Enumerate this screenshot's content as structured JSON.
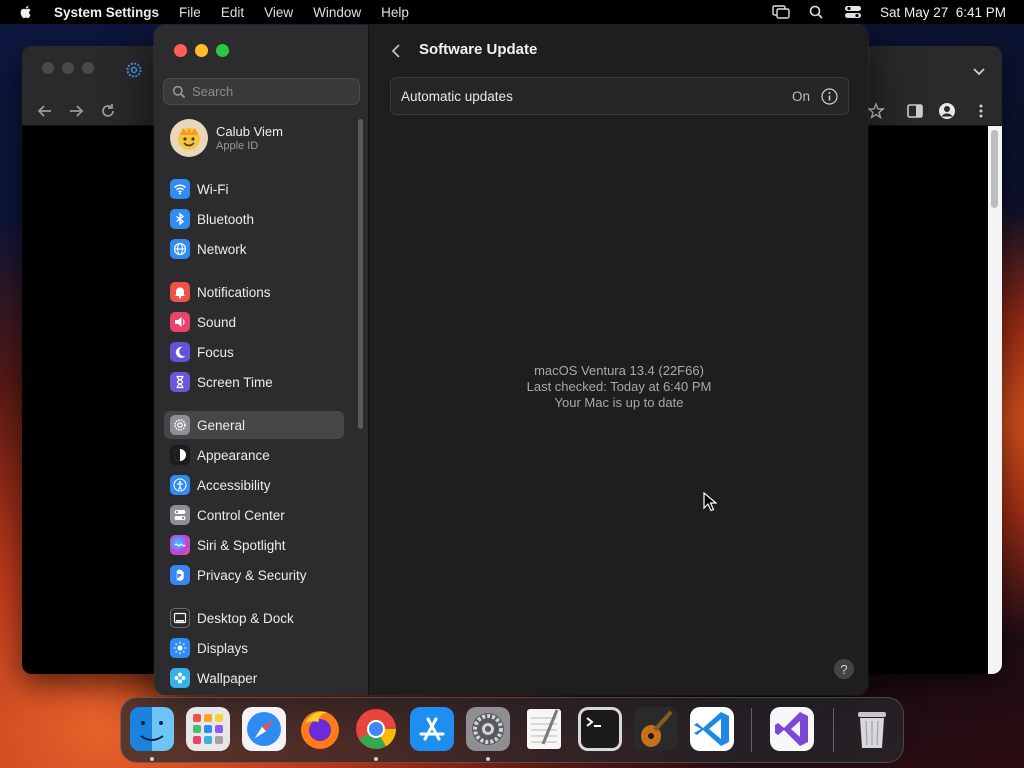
{
  "menubar": {
    "app_name": "System Settings",
    "menus": [
      "File",
      "Edit",
      "View",
      "Window",
      "Help"
    ],
    "datetime": "Sat May 27  6:41 PM"
  },
  "settings": {
    "search_placeholder": "Search",
    "profile": {
      "name": "Calub Viem",
      "subtitle": "Apple ID"
    },
    "sidebar_items": [
      {
        "label": "Wi-Fi",
        "icon": "wifi-icon",
        "color": "#2f8cf5"
      },
      {
        "label": "Bluetooth",
        "icon": "bluetooth-icon",
        "color": "#2f8cf5"
      },
      {
        "label": "Network",
        "icon": "globe-icon",
        "color": "#2f8cf5"
      },
      {
        "label": "Notifications",
        "icon": "bell-icon",
        "color": "#f0524a"
      },
      {
        "label": "Sound",
        "icon": "speaker-icon",
        "color": "#e8436a"
      },
      {
        "label": "Focus",
        "icon": "moon-icon",
        "color": "#6155d6"
      },
      {
        "label": "Screen Time",
        "icon": "hourglass-icon",
        "color": "#6a58d8"
      },
      {
        "label": "General",
        "icon": "gear-icon",
        "color": "#8e8e93"
      },
      {
        "label": "Appearance",
        "icon": "appearance-icon",
        "color": "#1c1c1e"
      },
      {
        "label": "Accessibility",
        "icon": "accessibility-icon",
        "color": "#2f8cf5"
      },
      {
        "label": "Control Center",
        "icon": "toggles-icon",
        "color": "#8e8e93"
      },
      {
        "label": "Siri & Spotlight",
        "icon": "siri-icon",
        "color": "#b847d8"
      },
      {
        "label": "Privacy & Security",
        "icon": "hand-icon",
        "color": "#3a86f0"
      },
      {
        "label": "Desktop & Dock",
        "icon": "dock-icon",
        "color": "#2c2c2e"
      },
      {
        "label": "Displays",
        "icon": "sun-icon",
        "color": "#2f8cf5"
      },
      {
        "label": "Wallpaper",
        "icon": "flower-icon",
        "color": "#38b0e8"
      }
    ],
    "selected_item": "General",
    "page_title": "Software Update",
    "automatic_updates": {
      "label": "Automatic updates",
      "value": "On"
    },
    "status": {
      "version": "macOS Ventura 13.4 (22F66)",
      "last_checked": "Last checked: Today at 6:40 PM",
      "message": "Your Mac is up to date"
    },
    "help_label": "?"
  },
  "dock": {
    "apps": [
      "Finder",
      "Launchpad",
      "Safari",
      "Firefox",
      "Chrome",
      "App Store",
      "System Settings",
      "TextEdit",
      "Terminal",
      "GarageBand",
      "Visual Studio Code",
      "Visual Studio",
      "Trash"
    ]
  }
}
